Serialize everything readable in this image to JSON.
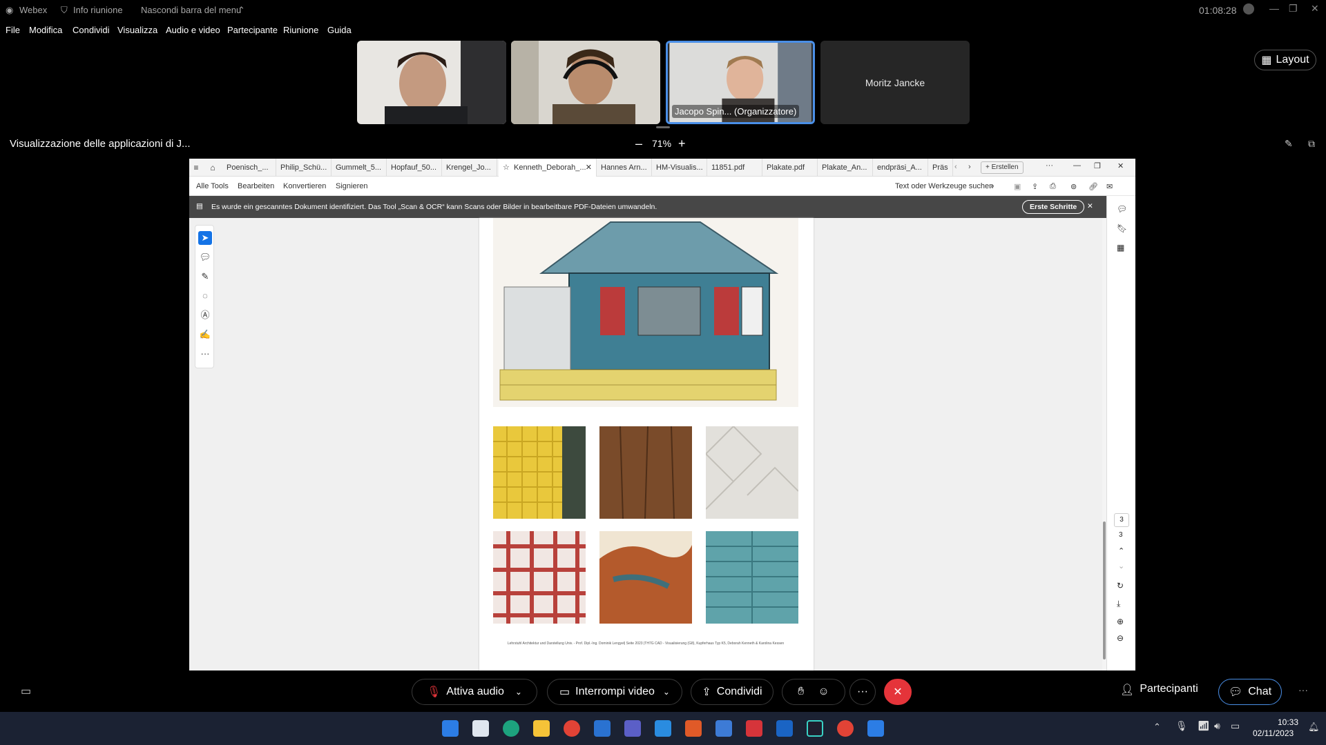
{
  "webex": {
    "app_name": "Webex",
    "info_label": "Info riunione",
    "hide_menu_label": "Nascondi barra del menu",
    "timer": "01:08:28",
    "menu": [
      "File",
      "Modifica",
      "Condividi",
      "Visualizza",
      "Audio e video",
      "Partecipante",
      "Riunione",
      "Guida"
    ],
    "layout_label": "Layout",
    "share_title": "Visualizzazione delle applicazioni di J...",
    "zoom_level": "71%",
    "zoom_minus": "–",
    "zoom_plus": "+"
  },
  "tiles": [
    {
      "name": ""
    },
    {
      "name": ""
    },
    {
      "name": "Jacopo Spin... (Organizzatore)"
    },
    {
      "name": "Moritz Jancke"
    }
  ],
  "acrobat": {
    "tabs": [
      "Poenisch_...",
      "Philip_Schü...",
      "Gummelt_5...",
      "Hopfauf_50...",
      "Krengel_Jo...",
      "Kenneth_Deborah_...",
      "Hannes Arn...",
      "HM-Visualis...",
      "11851.pdf",
      "Plakate.pdf",
      "Plakate_An...",
      "endpräsi_A...",
      "Präs"
    ],
    "create_label": "+ Erstellen",
    "toolbar": [
      "Alle Tools",
      "Bearbeiten",
      "Konvertieren",
      "Signieren"
    ],
    "search_label": "Text oder Werkzeuge suchen",
    "banner_text": "Es wurde ein gescanntes Dokument identifiziert. Das Tool „Scan & OCR“ kann Scans oder Bilder in bearbeitbare PDF-Dateien umwandeln.",
    "banner_button": "Erste Schritte",
    "page_current": "3",
    "page_total": "3",
    "footer_caption": "Lehrstuhl Architektur und Darstellung Univ. - Prof. Dipl.-Ing. Dominik Lengyel| Seite 2023 |TH7G CAD - Visualisierung (G8), Kupferhaus Typ K5, Deborah Kenneth & Karolina Kessen"
  },
  "controls": {
    "audio": "Attiva audio",
    "video": "Interrompi video",
    "share": "Condividi",
    "participants": "Partecipanti",
    "chat": "Chat"
  },
  "taskbar": {
    "time": "10:33",
    "date": "02/11/2023"
  },
  "colors": {
    "end_call": "#e5343a",
    "selected_tile_border": "#4a8fe7",
    "acrobat_banner": "#474747"
  }
}
